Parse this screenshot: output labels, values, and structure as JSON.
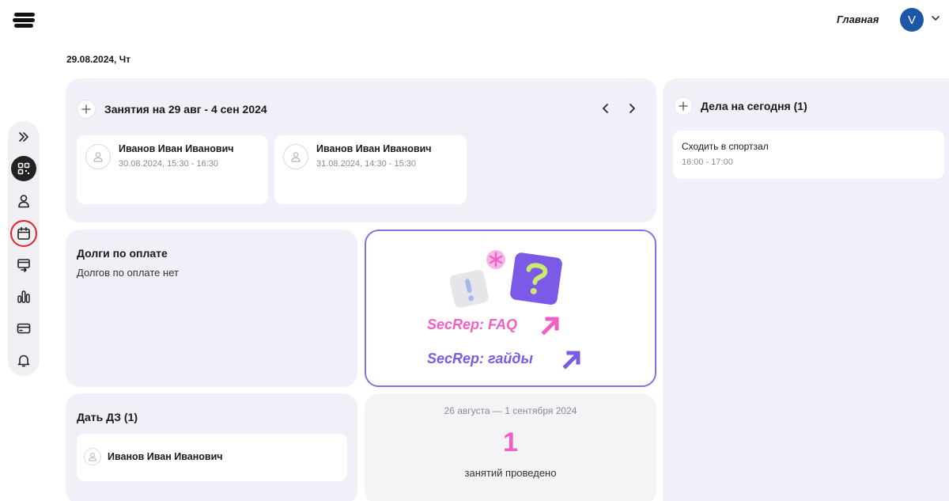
{
  "header": {
    "nav_link": "Главная",
    "user_initial": "V"
  },
  "date_label": "29.08.2024, Чт",
  "lessons": {
    "title": "Занятия на 29 авг - 4 сен 2024",
    "items": [
      {
        "name": "Иванов Иван Иванович",
        "time": "30.08.2024, 15:30 - 16:30"
      },
      {
        "name": "Иванов Иван Иванович",
        "time": "31.08.2024, 14:30 - 15:30"
      }
    ]
  },
  "todos": {
    "title": "Дела на сегодня (1)",
    "items": [
      {
        "name": "Сходить в спортзал",
        "time": "16:00 - 17:00"
      }
    ]
  },
  "debts": {
    "title": "Долги по оплате",
    "empty_text": "Долгов по оплате нет"
  },
  "faq": {
    "faq_label": "SecRep: FAQ",
    "guides_label": "SecRep: гайды",
    "faq_color": "#f25fc4",
    "guides_color": "#7a5ae6"
  },
  "homework": {
    "title": "Дать ДЗ (1)",
    "items": [
      {
        "name": "Иванов Иван Иванович"
      }
    ]
  },
  "stats": {
    "period": "26 августа — 1 сентября 2024",
    "count": "1",
    "caption": "занятий проведено",
    "count_color": "#f25fc4"
  },
  "sidebar": {
    "icons": [
      "expand-icon",
      "dashboard-icon",
      "user-icon",
      "calendar-icon",
      "transfer-icon",
      "stats-icon",
      "card-icon",
      "bell-icon"
    ]
  }
}
